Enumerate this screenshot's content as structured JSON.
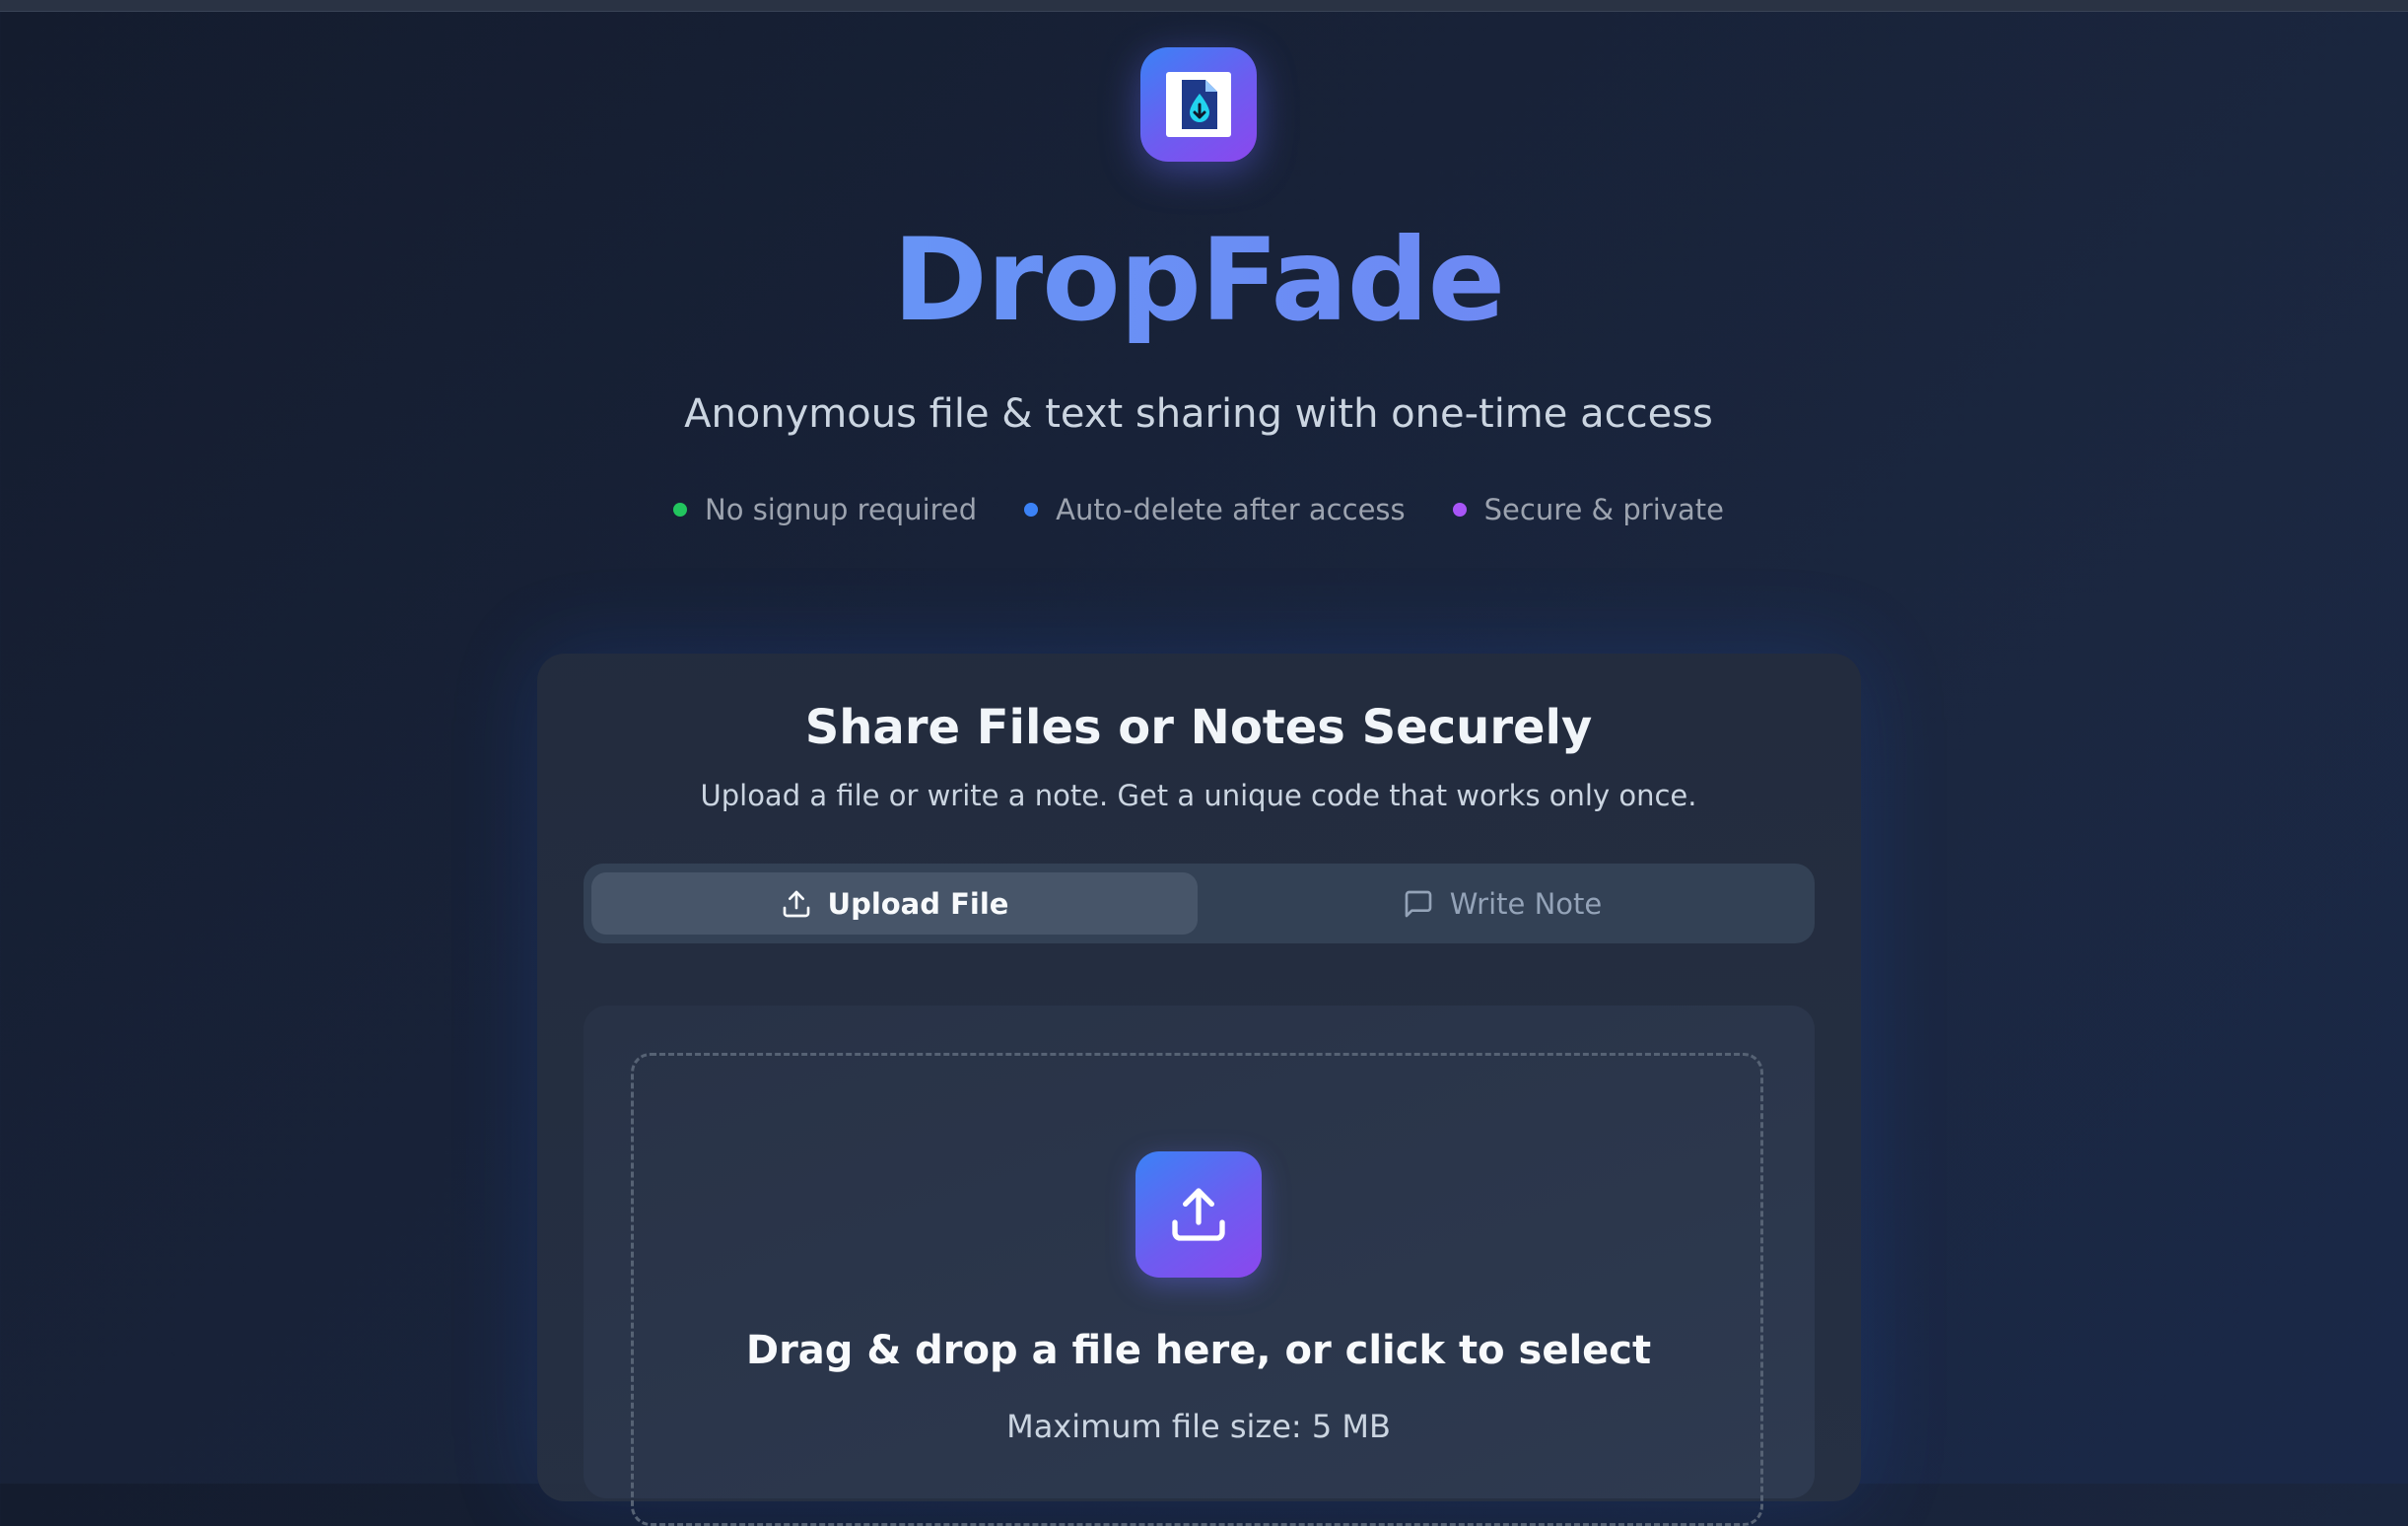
{
  "app": {
    "name": "DropFade",
    "tagline": "Anonymous file & text sharing with one-time access",
    "logo_icon": "file-drop-icon"
  },
  "features": [
    {
      "label": "No signup required",
      "color": "#22c55e"
    },
    {
      "label": "Auto-delete after access",
      "color": "#3b82f6"
    },
    {
      "label": "Secure & private",
      "color": "#a855f7"
    }
  ],
  "card": {
    "title": "Share Files or Notes Securely",
    "subtitle": "Upload a file or write a note. Get a unique code that works only once."
  },
  "tabs": [
    {
      "label": "Upload File",
      "icon": "upload-icon",
      "active": true
    },
    {
      "label": "Write Note",
      "icon": "message-square-icon",
      "active": false
    }
  ],
  "dropzone": {
    "title": "Drag & drop a file here, or click to select",
    "hint": "Maximum file size: 5 MB",
    "icon": "upload-icon"
  },
  "colors": {
    "accent_start": "#3b82f6",
    "accent_end": "#8b47ee",
    "background": "#182238"
  }
}
